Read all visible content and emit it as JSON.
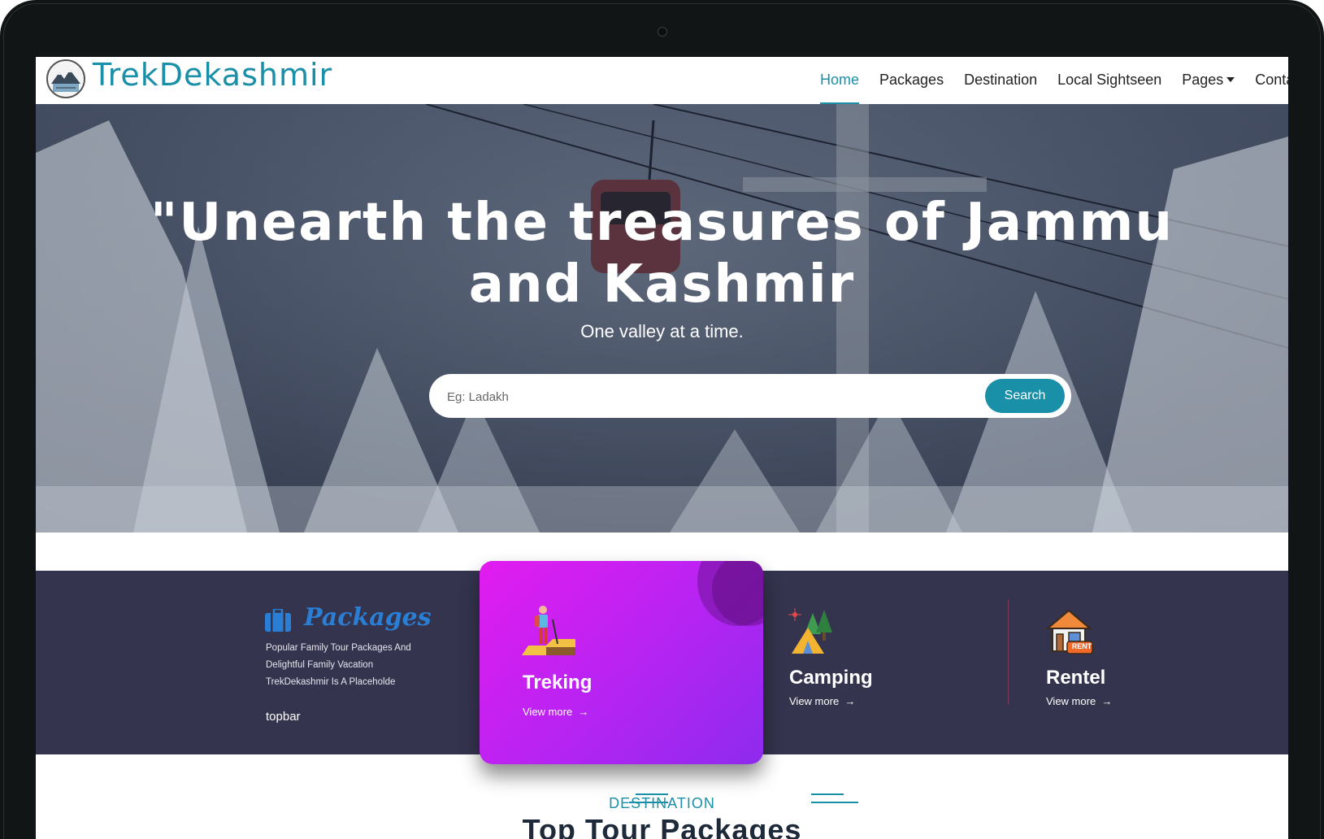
{
  "brand": {
    "name": "TrekDekashmir"
  },
  "nav": {
    "items": [
      {
        "label": "Home"
      },
      {
        "label": "Packages"
      },
      {
        "label": "Destination"
      },
      {
        "label": "Local Sightseen"
      },
      {
        "label": "Pages"
      },
      {
        "label": "Conta"
      }
    ]
  },
  "hero": {
    "title_line1": "\"Unearth the treasures of Jammu",
    "title_line2": "and Kashmir",
    "subtitle": "One valley at a time.",
    "search_placeholder": "Eg: Ladakh",
    "search_button": "Search"
  },
  "services": {
    "packages": {
      "title": "Packages",
      "desc_line1": "Popular Family Tour Packages And",
      "desc_line2": "Delightful Family Vacation",
      "desc_line3": "TrekDekashmir Is A Placeholde",
      "footer": "topbar"
    },
    "cards": [
      {
        "title": "Treking",
        "link": "View more",
        "arrow": "→"
      },
      {
        "title": "Camping",
        "link": "View more",
        "arrow": "→"
      },
      {
        "title": "Rentel",
        "link": "View more",
        "arrow": "→",
        "badge": "RENT"
      }
    ]
  },
  "destination": {
    "label": "DESTINATION",
    "heading": "Top Tour Packages"
  },
  "colors": {
    "accent": "#1a8fa8",
    "band": "#35344f",
    "card_gradient_start": "#e21cf0",
    "card_gradient_end": "#8e2bee",
    "packages_title": "#2a7fd4"
  },
  "icons": {
    "logo": "mountain-logo-icon",
    "packages": "suitcase-icon",
    "treking": "hiker-icon",
    "camping": "tent-icon",
    "rentel": "house-rent-icon",
    "link_arrow": "arrow-right-icon"
  }
}
